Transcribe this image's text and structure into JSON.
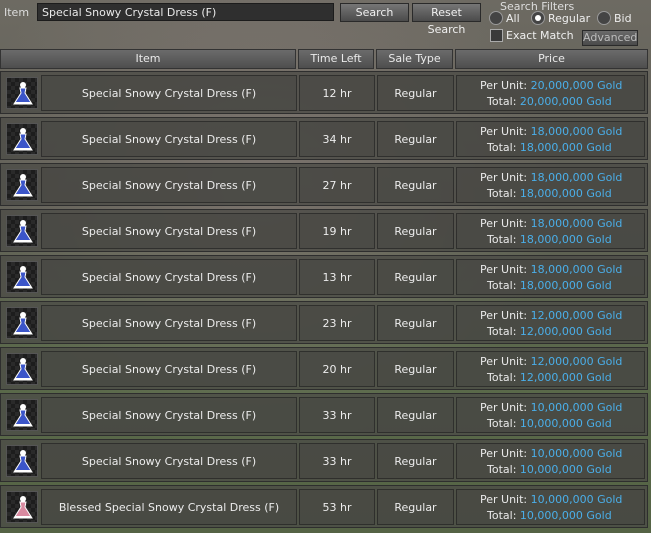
{
  "topbar": {
    "item_label": "Item",
    "search_value": "Special Snowy Crystal Dress (F)",
    "search_button": "Search",
    "reset_button": "Reset Search",
    "filters_title": "Search Filters",
    "radio_all": "All",
    "radio_regular": "Regular",
    "radio_bid": "Bid",
    "selected_filter": "Regular",
    "exact_match": "Exact Match",
    "advanced": "Advanced"
  },
  "columns": {
    "item": "Item",
    "time_left": "Time Left",
    "sale_type": "Sale Type",
    "price": "Price"
  },
  "labels": {
    "per_unit": "Per Unit:",
    "total": "Total:"
  },
  "colors": {
    "price_value": "#4aaee8",
    "icon_blue": "#3b55c9",
    "icon_pink": "#d98aa0"
  },
  "rows": [
    {
      "item": "Special Snowy Crystal Dress (F)",
      "icon": "blue-dress-icon",
      "time": "12 hr",
      "sale": "Regular",
      "per_unit": "20,000,000 Gold",
      "total": "20,000,000 Gold"
    },
    {
      "item": "Special Snowy Crystal Dress (F)",
      "icon": "blue-dress-icon",
      "time": "34 hr",
      "sale": "Regular",
      "per_unit": "18,000,000 Gold",
      "total": "18,000,000 Gold"
    },
    {
      "item": "Special Snowy Crystal Dress (F)",
      "icon": "blue-dress-icon",
      "time": "27 hr",
      "sale": "Regular",
      "per_unit": "18,000,000 Gold",
      "total": "18,000,000 Gold"
    },
    {
      "item": "Special Snowy Crystal Dress (F)",
      "icon": "blue-dress-icon",
      "time": "19 hr",
      "sale": "Regular",
      "per_unit": "18,000,000 Gold",
      "total": "18,000,000 Gold"
    },
    {
      "item": "Special Snowy Crystal Dress (F)",
      "icon": "blue-dress-icon",
      "time": "13 hr",
      "sale": "Regular",
      "per_unit": "18,000,000 Gold",
      "total": "18,000,000 Gold"
    },
    {
      "item": "Special Snowy Crystal Dress (F)",
      "icon": "blue-dress-icon",
      "time": "23 hr",
      "sale": "Regular",
      "per_unit": "12,000,000 Gold",
      "total": "12,000,000 Gold"
    },
    {
      "item": "Special Snowy Crystal Dress (F)",
      "icon": "blue-dress-icon",
      "time": "20 hr",
      "sale": "Regular",
      "per_unit": "12,000,000 Gold",
      "total": "12,000,000 Gold"
    },
    {
      "item": "Special Snowy Crystal Dress (F)",
      "icon": "blue-dress-icon",
      "time": "33 hr",
      "sale": "Regular",
      "per_unit": "10,000,000 Gold",
      "total": "10,000,000 Gold"
    },
    {
      "item": "Special Snowy Crystal Dress (F)",
      "icon": "blue-dress-icon",
      "time": "33 hr",
      "sale": "Regular",
      "per_unit": "10,000,000 Gold",
      "total": "10,000,000 Gold"
    },
    {
      "item": "Blessed Special Snowy Crystal Dress (F)",
      "icon": "pink-dress-icon",
      "time": "53 hr",
      "sale": "Regular",
      "per_unit": "10,000,000 Gold",
      "total": "10,000,000 Gold"
    }
  ]
}
